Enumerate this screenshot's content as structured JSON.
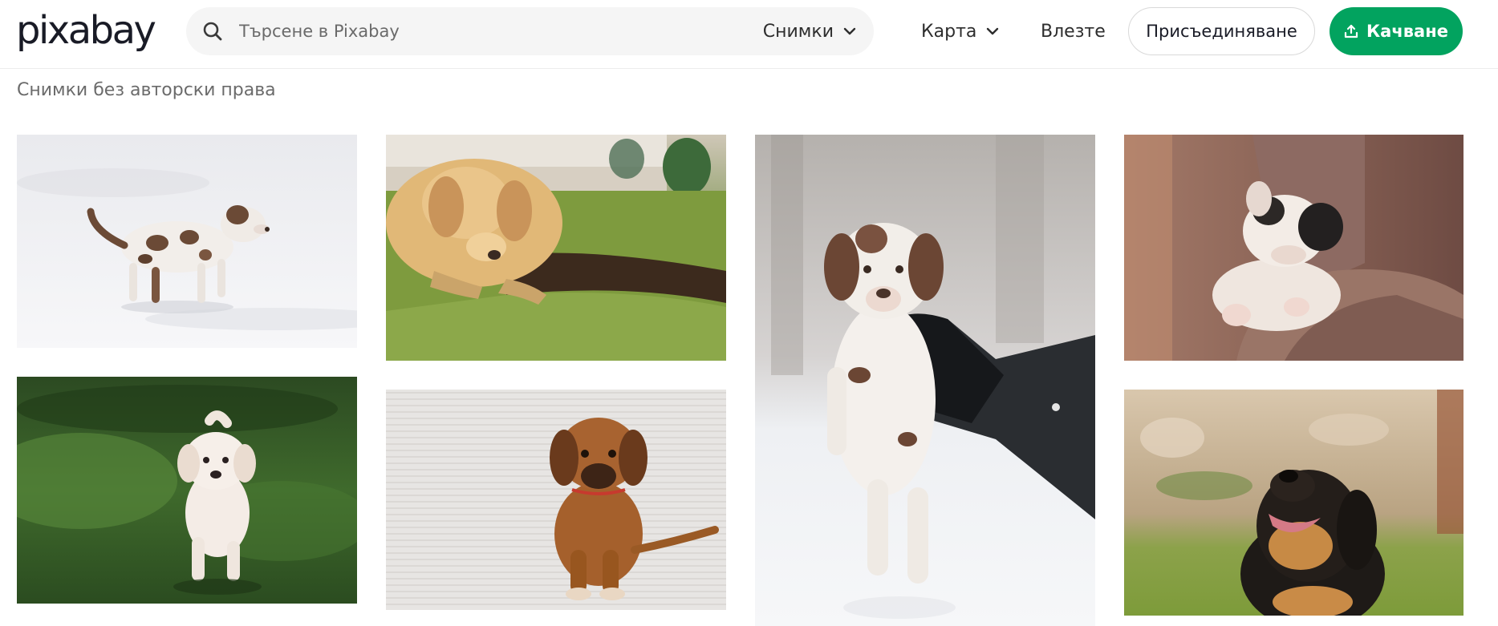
{
  "header": {
    "logo_text": "pixabay",
    "search": {
      "placeholder": "Търсене в Pixabay",
      "value": "",
      "type_label": "Снимки"
    },
    "explore_label": "Карта",
    "login_label": "Влезте",
    "join_label": "Присъединяване",
    "upload_label": "Качване"
  },
  "page": {
    "subtitle": "Снимки без авторски права"
  },
  "colors": {
    "accent": "#02a35f",
    "text": "#191b26",
    "muted": "#6b6b6b",
    "search_bg": "#f5f5f5"
  },
  "icons": {
    "search": "search-icon",
    "chevron": "chevron-down-icon",
    "upload": "upload-icon"
  },
  "gallery": {
    "photos": [
      {
        "subject": "spotted puppy walking in snow"
      },
      {
        "subject": "golden retriever puppy sniffing a puddle in grass"
      },
      {
        "subject": "spotted puppy held by a gloved hand in snow"
      },
      {
        "subject": "bulldog puppy sleeping in sweater sleeve"
      },
      {
        "subject": "white puppy running on grass"
      },
      {
        "subject": "brown puppy sitting on carpet"
      },
      {
        "subject": "black and tan puppy looking up"
      }
    ]
  }
}
